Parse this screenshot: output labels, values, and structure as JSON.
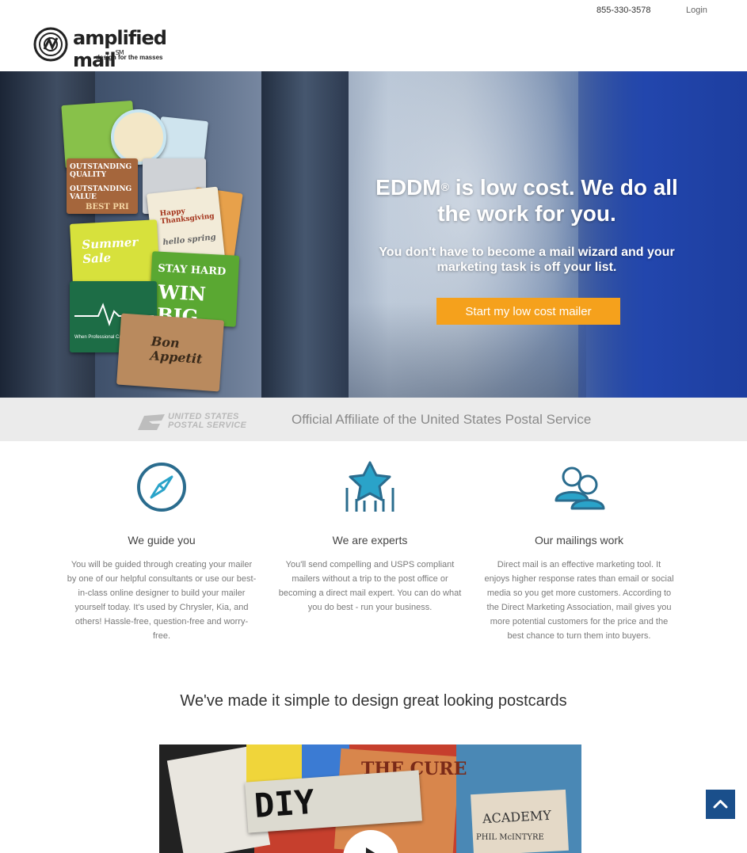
{
  "header": {
    "phone": "855-330-3578",
    "login": "Login",
    "logo_word": "amplified mail",
    "logo_tm": "SM",
    "logo_tagline": "design for the masses"
  },
  "hero": {
    "title_part1": "EDDM",
    "title_reg": "®",
    "title_part2": " is low cost. We do all the work for you.",
    "subtitle": "You don't have to become a mail wizard and your marketing task is off your list.",
    "cta": "Start my low cost mailer",
    "postcards": {
      "outstanding": "OUTSTANDING QUALITY",
      "value": "OUTSTANDING VALUE",
      "best": "BEST PRI",
      "summer": "Summer Sale",
      "happy": "Happy Thanksgiving",
      "hello": "hello spring",
      "stay": "STAY HARD",
      "win": "WIN BIG",
      "bon": "Bon Appetit",
      "care": "When Professional Care Matters"
    }
  },
  "usps": {
    "logo_line1": "UNITED STATES",
    "logo_line2": "POSTAL SERVICE",
    "affiliate": "Official Affiliate of the United States Postal Service"
  },
  "features": [
    {
      "icon": "compass-icon",
      "title": "We guide you",
      "body": "You will be guided through creating your mailer by one of our helpful consultants or use our best-in-class online designer to build your mailer yourself today. It's used by Chrysler, Kia, and others! Hassle-free, question-free and worry-free."
    },
    {
      "icon": "star-icon",
      "title": "We are experts",
      "body": "You'll send compelling and USPS compliant mailers without a trip to the post office or becoming a direct mail expert. You can do what you do best - run your business."
    },
    {
      "icon": "people-icon",
      "title": "Our mailings work",
      "body": "Direct mail is an effective marketing tool. It enjoys higher response rates than email or social media so you get more customers. According to the Direct Marketing Association, mail gives you more potential customers for the price and the best chance to turn them into buyers."
    }
  ],
  "section_title": "We've made it simple to design great looking postcards",
  "video": {
    "diy": "DIY",
    "the_cure": "THE CURE",
    "academy": "ACADEMY",
    "phil": "PHIL McINTYRE"
  },
  "colors": {
    "accent_orange": "#f5a11c",
    "icon_blue": "#2a6c8e",
    "icon_teal": "#2aa3c9",
    "to_top_blue": "#1a4f8b"
  }
}
